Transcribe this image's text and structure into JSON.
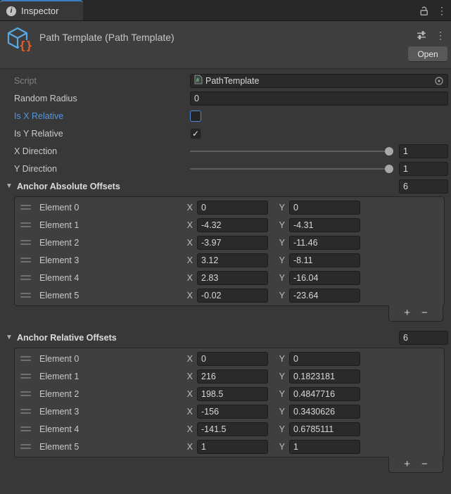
{
  "tab_bar": {
    "title": "Inspector"
  },
  "header": {
    "title": "Path Template (Path Template)",
    "open_button": "Open"
  },
  "inspector": {
    "script_label": "Script",
    "script_value": "PathTemplate",
    "random_radius_label": "Random Radius",
    "random_radius_value": "0",
    "is_x_relative_label": "Is X Relative",
    "is_y_relative_label": "Is Y Relative",
    "x_direction_label": "X Direction",
    "x_direction_value": "1",
    "y_direction_label": "Y Direction",
    "y_direction_value": "1"
  },
  "checkboxes": {
    "is_x_relative_checked": false,
    "is_y_relative_checked": true
  },
  "axis": {
    "x": "X",
    "y": "Y"
  },
  "icons": {
    "info": "i",
    "foldout_open": "▼",
    "kebab": "⋮",
    "add": "+",
    "remove": "−",
    "check": "✓"
  },
  "lists": [
    {
      "title": "Anchor Absolute Offsets",
      "size": "6",
      "elements": [
        {
          "label": "Element 0",
          "x": "0",
          "y": "0"
        },
        {
          "label": "Element 1",
          "x": "-4.32",
          "y": "-4.31"
        },
        {
          "label": "Element 2",
          "x": "-3.97",
          "y": "-11.46"
        },
        {
          "label": "Element 3",
          "x": "3.12",
          "y": "-8.11"
        },
        {
          "label": "Element 4",
          "x": "2.83",
          "y": "-16.04"
        },
        {
          "label": "Element 5",
          "x": "-0.02",
          "y": "-23.64"
        }
      ]
    },
    {
      "title": "Anchor Relative Offsets",
      "size": "6",
      "elements": [
        {
          "label": "Element 0",
          "x": "0",
          "y": "0"
        },
        {
          "label": "Element 1",
          "x": "216",
          "y": "0.1823181"
        },
        {
          "label": "Element 2",
          "x": "198.5",
          "y": "0.4847716"
        },
        {
          "label": "Element 3",
          "x": "-156",
          "y": "0.3430626"
        },
        {
          "label": "Element 4",
          "x": "-141.5",
          "y": "0.6785111"
        },
        {
          "label": "Element 5",
          "x": "1",
          "y": "1"
        }
      ]
    }
  ],
  "colors": {
    "tab_accent": "#3d7dc4",
    "focused_border": "#4a8ad4",
    "blue_label": "#5596dc",
    "script_icon_blue": "#58a7e2",
    "script_icon_orange": "#e8612c"
  }
}
